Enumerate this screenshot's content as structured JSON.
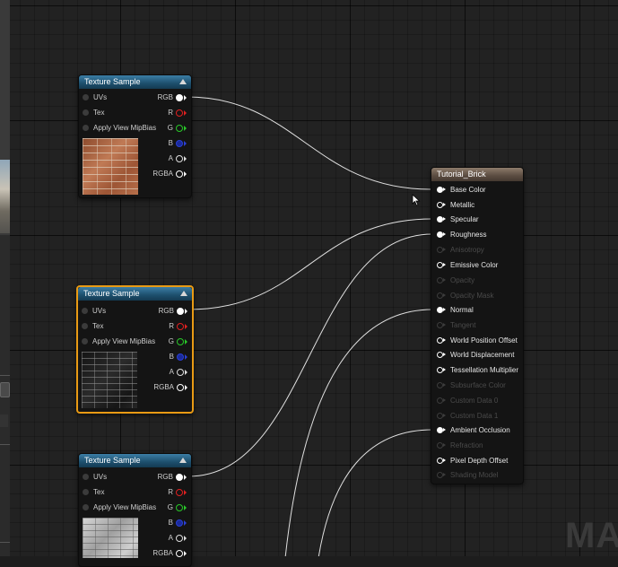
{
  "colors": {
    "header_blue": "#1d4f6d",
    "header_result": "#5b4c41",
    "selection_orange": "#e89a14",
    "pin_r": "#e02020",
    "pin_g": "#28c828",
    "pin_b": "#2a3fd6",
    "wire": "#e0e0e0"
  },
  "texture_nodes": [
    {
      "title": "Texture Sample",
      "inputs": [
        "UVs",
        "Tex",
        "Apply View MipBias"
      ],
      "outputs": [
        "RGB",
        "R",
        "G",
        "B",
        "A",
        "RGBA"
      ],
      "thumbnail": "red-brick",
      "selected": false
    },
    {
      "title": "Texture Sample",
      "inputs": [
        "UVs",
        "Tex",
        "Apply View MipBias"
      ],
      "outputs": [
        "RGB",
        "R",
        "G",
        "B",
        "A",
        "RGBA"
      ],
      "thumbnail": "dark-brick-normal",
      "selected": true
    },
    {
      "title": "Texture Sample",
      "inputs": [
        "UVs",
        "Tex",
        "Apply View MipBias"
      ],
      "outputs": [
        "RGB",
        "R",
        "G",
        "B",
        "A",
        "RGBA"
      ],
      "thumbnail": "white-brick-grayscale",
      "selected": false
    }
  ],
  "result_node": {
    "title": "Tutorial_Brick",
    "inputs": [
      {
        "label": "Base Color",
        "active": true,
        "linked": true
      },
      {
        "label": "Metallic",
        "active": true,
        "linked": false
      },
      {
        "label": "Specular",
        "active": true,
        "linked": true
      },
      {
        "label": "Roughness",
        "active": true,
        "linked": true
      },
      {
        "label": "Anisotropy",
        "active": false,
        "linked": false
      },
      {
        "label": "Emissive Color",
        "active": true,
        "linked": false
      },
      {
        "label": "Opacity",
        "active": false,
        "linked": false
      },
      {
        "label": "Opacity Mask",
        "active": false,
        "linked": false
      },
      {
        "label": "Normal",
        "active": true,
        "linked": true
      },
      {
        "label": "Tangent",
        "active": false,
        "linked": false
      },
      {
        "label": "World Position Offset",
        "active": true,
        "linked": false
      },
      {
        "label": "World Displacement",
        "active": true,
        "linked": false
      },
      {
        "label": "Tessellation Multiplier",
        "active": true,
        "linked": false
      },
      {
        "label": "Subsurface Color",
        "active": false,
        "linked": false
      },
      {
        "label": "Custom Data 0",
        "active": false,
        "linked": false
      },
      {
        "label": "Custom Data 1",
        "active": false,
        "linked": false
      },
      {
        "label": "Ambient Occlusion",
        "active": true,
        "linked": true
      },
      {
        "label": "Refraction",
        "active": false,
        "linked": false
      },
      {
        "label": "Pixel Depth Offset",
        "active": true,
        "linked": false
      },
      {
        "label": "Shading Model",
        "active": false,
        "linked": false
      }
    ]
  },
  "connections": [
    {
      "from_node": 0,
      "from_pin": "RGB",
      "to_pin": "Base Color"
    },
    {
      "from_node": 1,
      "from_pin": "RGB",
      "to_pin": "Specular"
    },
    {
      "from_node": 2,
      "from_pin": "RGB",
      "to_pin": "Roughness"
    },
    {
      "from_node": "offscreen",
      "to_pin": "Normal"
    },
    {
      "from_node": "offscreen",
      "to_pin": "Ambient Occlusion"
    }
  ],
  "watermark": "MAT"
}
